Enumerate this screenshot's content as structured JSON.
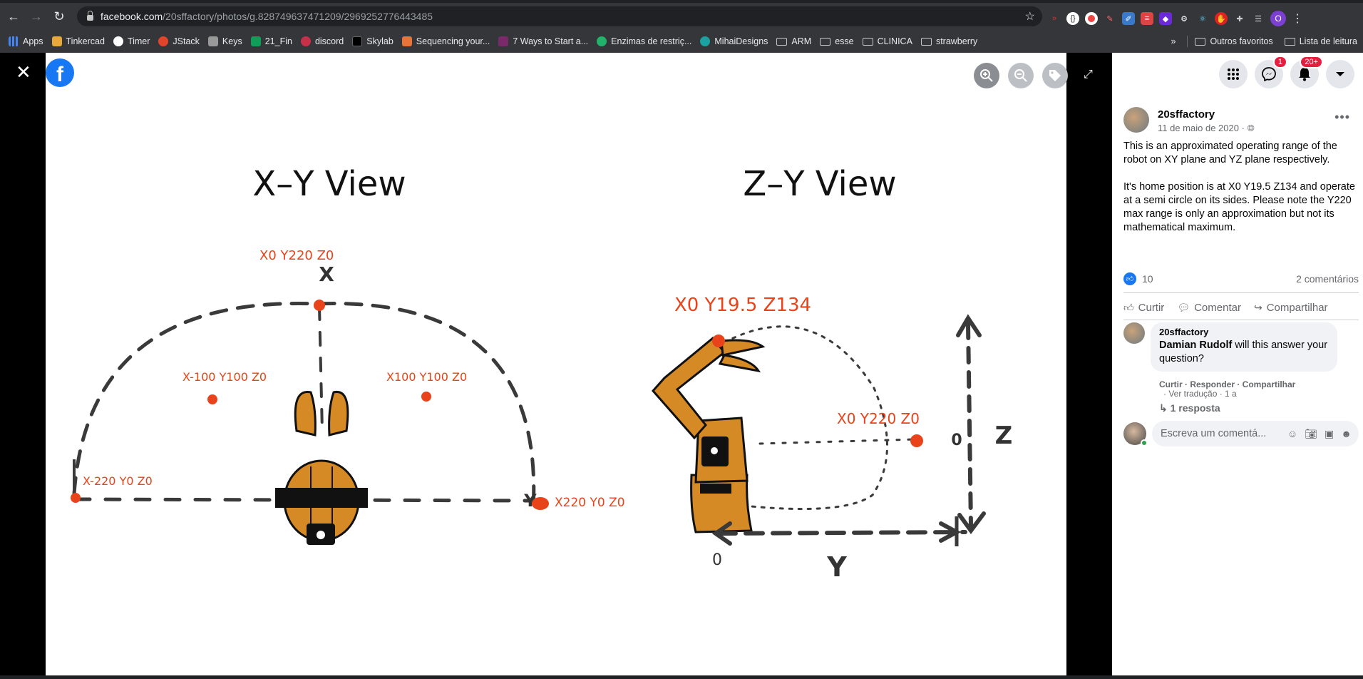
{
  "browser": {
    "url_host": "facebook.com",
    "url_path": "/20sffactory/photos/g.828749637471209/2969252776443485",
    "bookmarks": [
      "Apps",
      "Tinkercad",
      "Timer",
      "JStack",
      "Keys",
      "21_Fin",
      "discord",
      "Skylab",
      "Sequencing your...",
      "7 Ways to Start a...",
      "Enzimas de restriç...",
      "MihaiDesigns",
      "ARM",
      "esse",
      "CLINICA",
      "strawberry"
    ],
    "overflow": "»",
    "other_bookmarks": "Outros favoritos",
    "reading_list": "Lista de leitura",
    "profile_initial": "O"
  },
  "photo": {
    "left_title": "X–Y View",
    "right_title": "Z–Y View",
    "labels": {
      "top_point": "X0  Y220  Z0",
      "mid_left": "X-100 Y100  Z0",
      "mid_right": "X100  Y100 Z0",
      "far_left": "X-220  Y0    Z0",
      "far_right": "X220 Y0 Z0",
      "home": "X0 Y19.5 Z134",
      "zy_point": "X0 Y220 Z0",
      "axis_x": "X",
      "axis_y_left": "Y",
      "axis_y_bottom": "Y",
      "axis_z": "Z",
      "zero_left": "0",
      "zero_right": "0"
    }
  },
  "sidebar": {
    "badges": {
      "messenger": "1",
      "notifications": "20+"
    },
    "author": "20sffactory",
    "date": "11 de maio de 2020 ·",
    "post_text": "This is an approximated operating range of the robot on XY plane and YZ plane respectively.\n\nIt's home position is at X0 Y19.5 Z134 and operate at a semi circle on its sides. Please note the Y220 max range is only an approximation but not its mathematical maximum.",
    "likes": "10",
    "comments_count": "2 comentários",
    "actions": [
      "Curtir",
      "Comentar",
      "Compartilhar"
    ],
    "comment": {
      "author": "20sffactory",
      "mention": "Damian Rudolf",
      "text": " will this answer your question?",
      "meta": "Curtir · Responder · Compartilhar",
      "meta2": "· Ver tradução · 1 a",
      "replies": "1 resposta"
    },
    "write_placeholder": "Escreva um comentá..."
  },
  "colors": {
    "facebook_blue": "#1877f2",
    "sketch_red": "#e8431a",
    "robot_orange": "#d68a25"
  }
}
